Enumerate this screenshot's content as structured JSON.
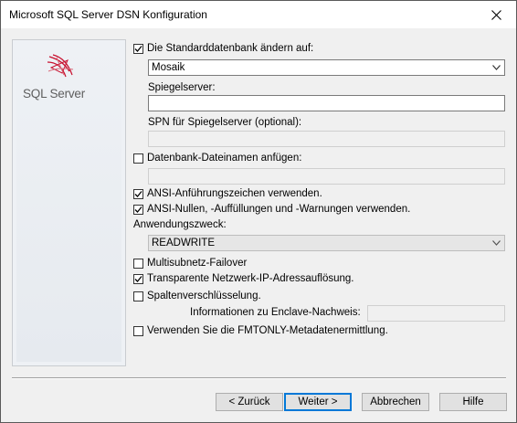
{
  "window": {
    "title": "Microsoft SQL Server DSN Konfiguration"
  },
  "sidebar": {
    "logo_text": "SQL Server"
  },
  "form": {
    "change_default_db": {
      "label": "Die Standarddatenbank ändern auf:",
      "checked": true
    },
    "default_db": {
      "value": "Mosaik"
    },
    "mirror_server": {
      "label": "Spiegelserver:",
      "value": ""
    },
    "spn_mirror": {
      "label": "SPN für Spiegelserver (optional):",
      "value": ""
    },
    "attach_db_filename": {
      "label": "Datenbank-Dateinamen anfügen:",
      "checked": false,
      "value": ""
    },
    "ansi_quotes": {
      "label": "ANSI-Anführungszeichen verwenden.",
      "checked": true
    },
    "ansi_nulls": {
      "label": "ANSI-Nullen, -Auffüllungen und -Warnungen verwenden.",
      "checked": true
    },
    "application_intent": {
      "label": "Anwendungszweck:",
      "value": "READWRITE"
    },
    "multisubnet_failover": {
      "label": "Multisubnetz-Failover",
      "checked": false
    },
    "transparent_ip": {
      "label": "Transparente Netzwerk-IP-Adressauflösung.",
      "checked": true
    },
    "column_encryption": {
      "label": "Spaltenverschlüsselung.",
      "checked": false
    },
    "enclave_attestation": {
      "label": "Informationen zu Enclave-Nachweis:",
      "value": ""
    },
    "fmtonly": {
      "label": "Verwenden Sie die FMTONLY-Metadatenermittlung.",
      "checked": false
    }
  },
  "buttons": {
    "back": "< Zurück",
    "next": "Weiter >",
    "cancel": "Abbrechen",
    "help": "Hilfe"
  },
  "icons": {
    "close": "close-icon",
    "checkmark": "checkmark-icon",
    "dropdown": "chevron-down-icon",
    "logo": "sql-server-logo-icon"
  },
  "colors": {
    "default_button_border": "#0078d7",
    "logo_red": "#c8102e"
  }
}
